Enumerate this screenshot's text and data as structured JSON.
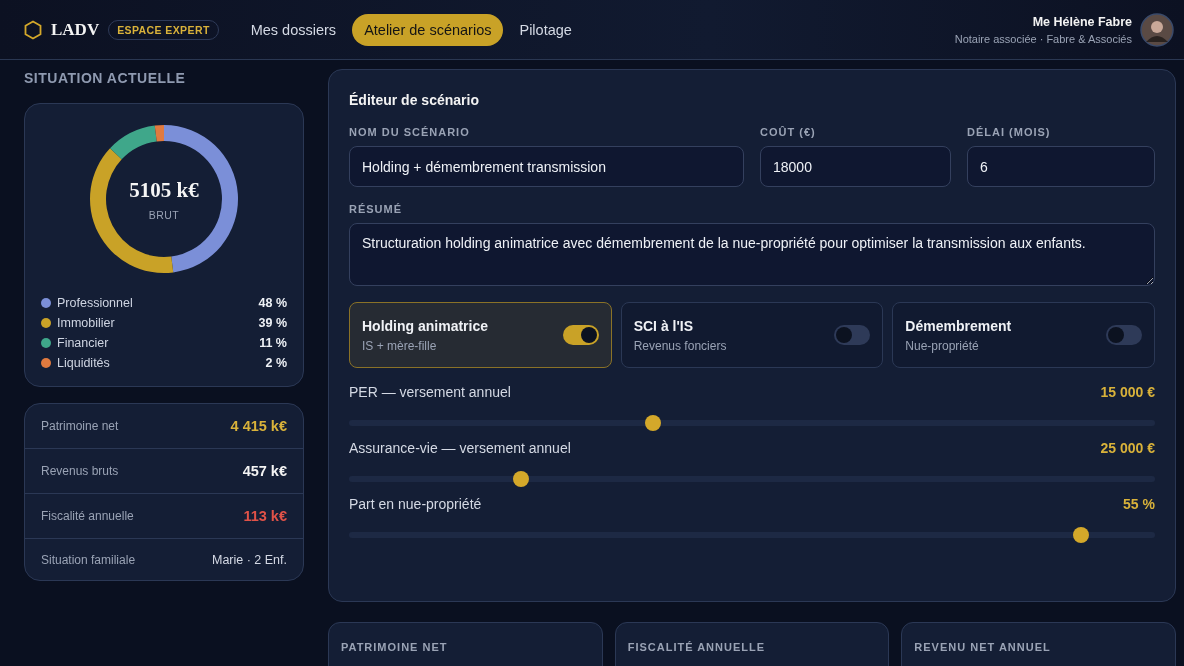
{
  "header": {
    "logo": "LADV",
    "badge": "ESPACE EXPERT",
    "nav": [
      {
        "label": "Mes dossiers",
        "selected": false
      },
      {
        "label": "Atelier de scénarios",
        "selected": true
      },
      {
        "label": "Pilotage",
        "selected": false
      }
    ],
    "user": {
      "name": "Me Hélène Fabre",
      "role": "Notaire associée · Fabre & Associés"
    }
  },
  "situation": {
    "title": "SITUATION ACTUELLE",
    "donut": {
      "center_value": "5105 k€",
      "center_label": "BRUT",
      "chart_data": {
        "type": "donut",
        "values": [
          48,
          39,
          11,
          2
        ]
      },
      "legend": [
        {
          "label": "Professionnel",
          "share": "48 %",
          "color": "#7b8fd8"
        },
        {
          "label": "Immobilier",
          "share": "39 %",
          "color": "#c9a227"
        },
        {
          "label": "Financier",
          "share": "11 %",
          "color": "#3fa78a"
        },
        {
          "label": "Liquidités",
          "share": "2 %",
          "color": "#e07a3f"
        }
      ]
    },
    "metrics": [
      {
        "label": "Patrimoine net",
        "value": "4 415 k€",
        "color": "#d9b23a"
      },
      {
        "label": "Revenus bruts",
        "value": "457 k€",
        "color": "#f3f3f3"
      },
      {
        "label": "Fiscalité annuelle",
        "value": "113 k€",
        "color": "#e05248"
      },
      {
        "label": "Situation familiale",
        "value": "Marie · 2 Enf.",
        "color": "#d4d9e4"
      }
    ]
  },
  "editor": {
    "title": "Éditeur de scénario",
    "fields": [
      {
        "label": "NOM DU SCÉNARIO",
        "value": "Holding + démembrement transmission"
      },
      {
        "label": "COÛT (€)",
        "value": "18000"
      },
      {
        "label": "DÉLAI (MOIS)",
        "value": "6"
      }
    ],
    "summary": {
      "label": "RÉSUMÉ",
      "value": "Structuration holding animatrice avec démembrement de la nue-propriété pour optimiser la transmission aux enfants."
    },
    "options": [
      {
        "title": "Holding animatrice",
        "subtitle": "IS + mère-fille",
        "on": true
      },
      {
        "title": "SCI à l'IS",
        "subtitle": "Revenus fonciers",
        "on": false
      },
      {
        "title": "Démembrement",
        "subtitle": "Nue-propriété",
        "on": false
      }
    ],
    "sliders": [
      {
        "label": "PER — versement annuel",
        "reading": "15 000 €",
        "level": 0.377
      },
      {
        "label": "Assurance-vie — versement annuel",
        "reading": "25 000 €",
        "level": 0.213
      },
      {
        "label": "Part en nue-propriété",
        "reading": "55 %",
        "level": 0.908
      }
    ]
  },
  "results": [
    {
      "label": "PATRIMOINE NET"
    },
    {
      "label": "FISCALITÉ ANNUELLE"
    },
    {
      "label": "REVENU NET ANNUEL"
    }
  ]
}
